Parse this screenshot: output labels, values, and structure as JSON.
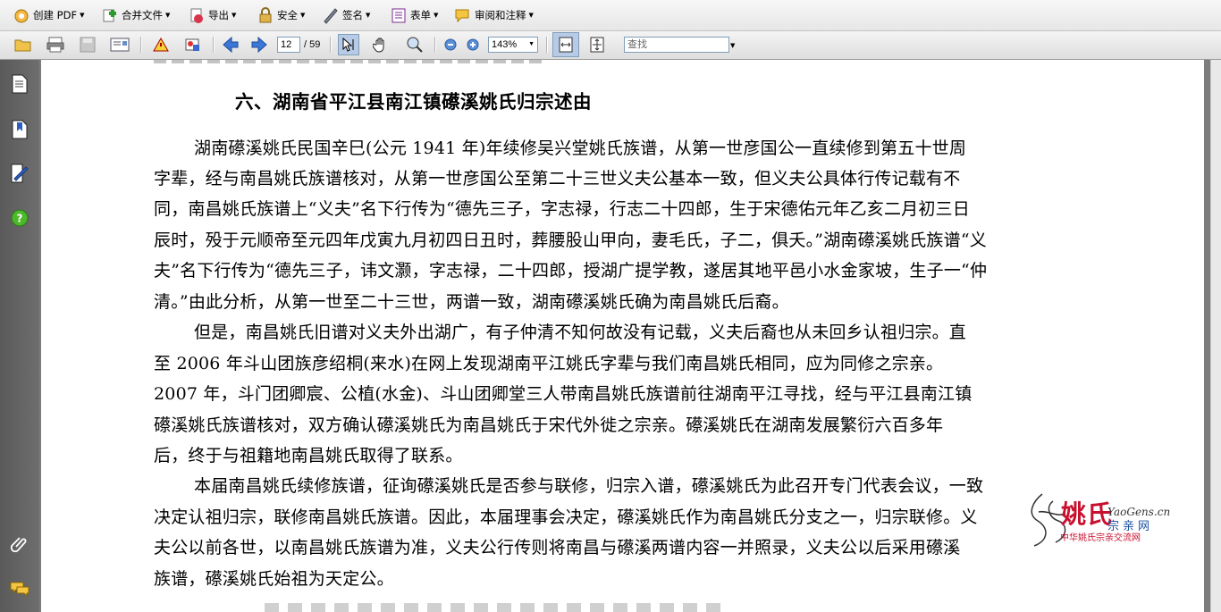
{
  "menubar": {
    "items": [
      {
        "label": "创建 PDF",
        "icon": "create-pdf-icon"
      },
      {
        "label": "合并文件",
        "icon": "combine-files-icon"
      },
      {
        "label": "导出",
        "icon": "export-icon"
      },
      {
        "label": "安全",
        "icon": "lock-icon"
      },
      {
        "label": "签名",
        "icon": "pen-icon"
      },
      {
        "label": "表单",
        "icon": "form-icon"
      },
      {
        "label": "审阅和注释",
        "icon": "comment-icon"
      }
    ]
  },
  "toolbar": {
    "page_current": "12",
    "page_total": "/ 59",
    "zoom": "143%",
    "search_placeholder": "查找"
  },
  "document": {
    "heading": "六、湖南省平江县南江镇礤溪姚氏归宗述由",
    "lines": [
      "湖南礤溪姚氏民国辛巳(公元 1941 年)年续修吴兴堂姚氏族谱，从第一世彦国公一直续修到第五十世周",
      "字辈，经与南昌姚氏族谱核对，从第一世彦国公至第二十三世义夫公基本一致，但义夫公具体行传记载有不",
      "同，南昌姚氏族谱上“义夫”名下行传为“德先三子，字志禄，行志二十四郎，生于宋德佑元年乙亥二月初三日",
      "辰时，殁于元顺帝至元四年戊寅九月初四日丑时，葬腰股山甲向，妻毛氏，子二，俱夭。”湖南礤溪姚氏族谱“义",
      "夫”名下行传为“德先三子，讳文灏，字志禄，二十四郎，授湖广提学教，遂居其地平邑小水金家坡，生子一“仲",
      "清。”由此分析，从第一世至二十三世，两谱一致，湖南礤溪姚氏确为南昌姚氏后裔。",
      "但是，南昌姚氏旧谱对义夫外出湖广，有子仲清不知何故没有记载，义夫后裔也从未回乡认祖归宗。直",
      "至 2006 年斗山团族彦绍桐(来水)在网上发现湖南平江姚氏字辈与我们南昌姚氏相同，应为同修之宗亲。",
      "2007 年，斗门团卿宸、公植(水金)、斗山团卿堂三人带南昌姚氏族谱前往湖南平江寻找，经与平江县南江镇",
      "礤溪姚氏族谱核对，双方确认礤溪姚氏为南昌姚氏于宋代外徙之宗亲。礤溪姚氏在湖南发展繁衍六百多年",
      "后，终于与祖籍地南昌姚氏取得了联系。",
      "本届南昌姚氏续修族谱，征询礤溪姚氏是否参与联修，归宗入谱，礤溪姚氏为此召开专门代表会议，一致",
      "决定认祖归宗，联修南昌姚氏族谱。因此，本届理事会决定，礤溪姚氏作为南昌姚氏分支之一，归宗联修。义",
      "夫公以前各世，以南昌姚氏族谱为准，义夫公行传则将南昌与礤溪两谱内容一并照录，义夫公以后采用礤溪",
      "族谱，礤溪姚氏始祖为天定公。"
    ]
  },
  "watermark": {
    "brand": "姚氏",
    "site": "YaoGens.cn",
    "line2": "宗亲网",
    "line3": "中华姚氏宗亲交流网"
  },
  "colors": {
    "accent": "#c8102e",
    "link": "#1c4fa0"
  }
}
